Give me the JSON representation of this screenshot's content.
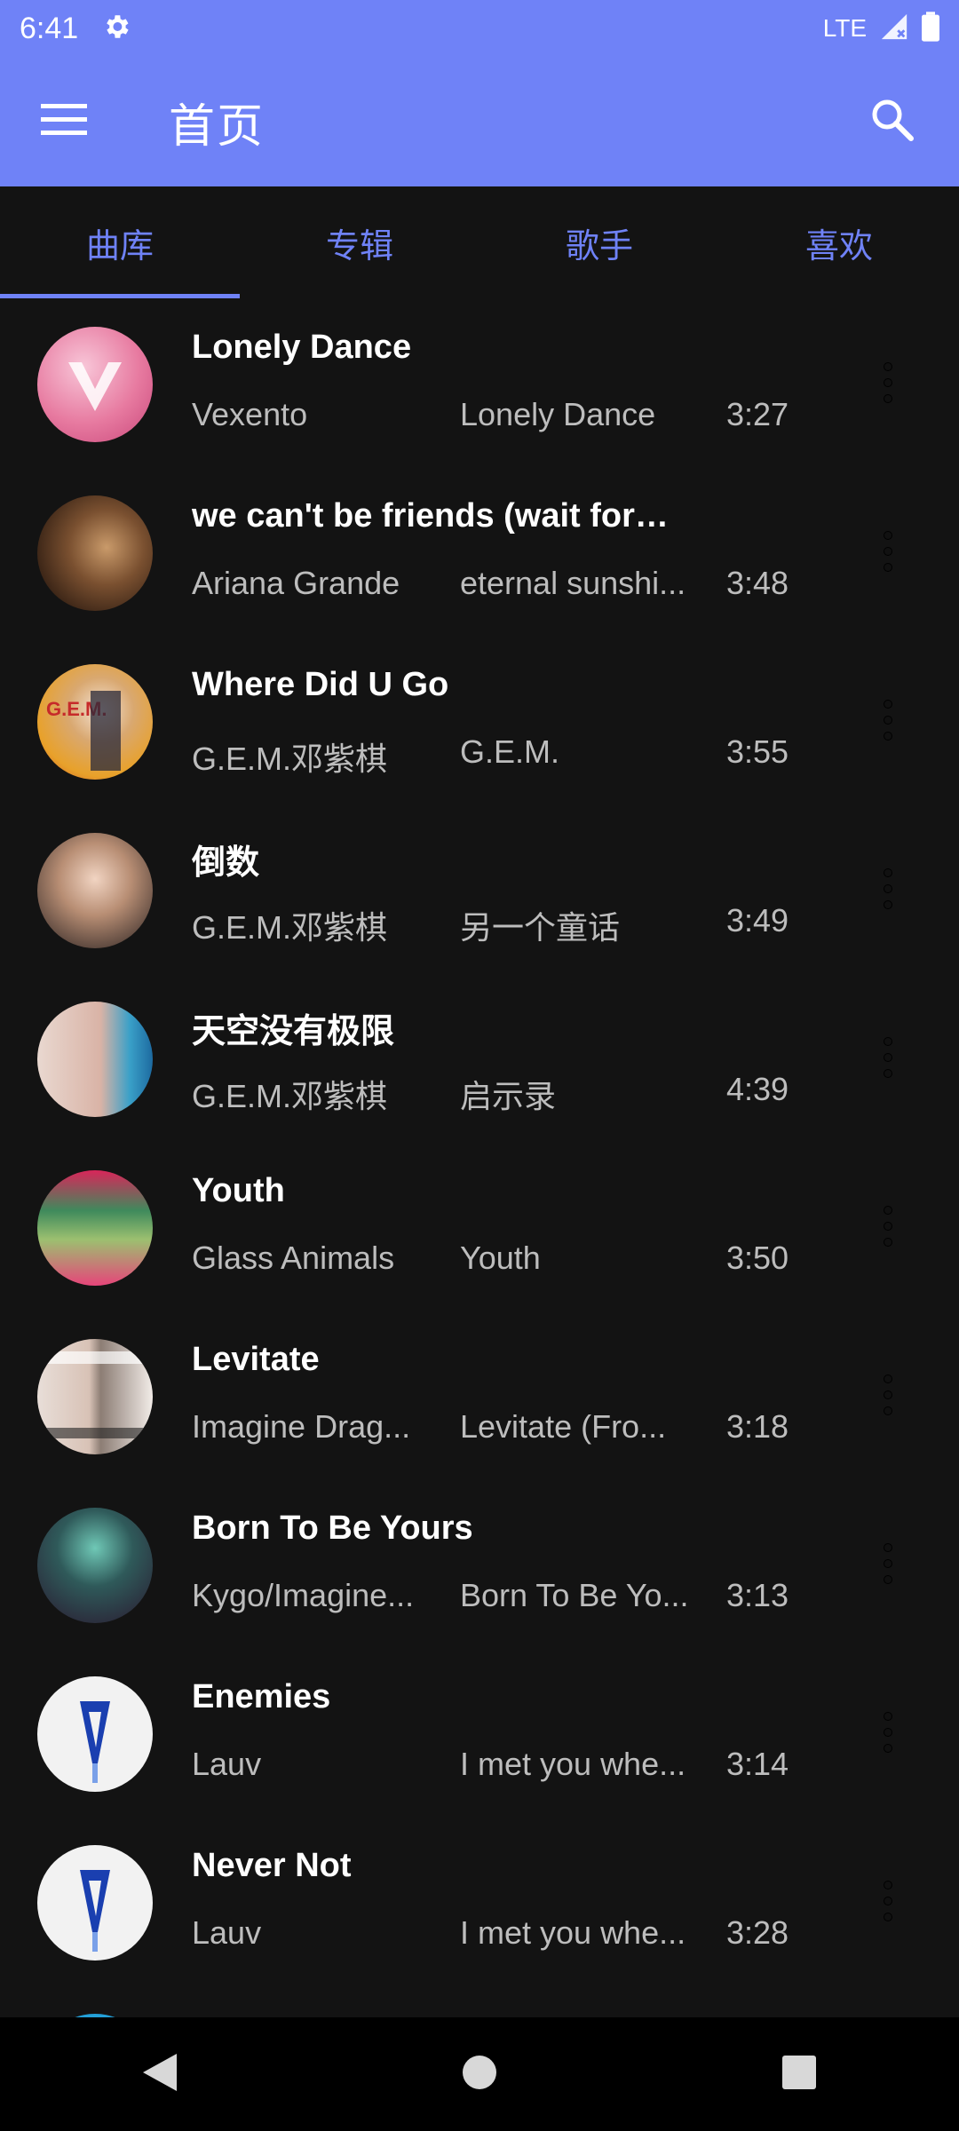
{
  "status_bar": {
    "time": "6:41",
    "network": "LTE"
  },
  "app_bar": {
    "title": "首页"
  },
  "tabs": [
    {
      "label": "曲库",
      "active": true
    },
    {
      "label": "专辑",
      "active": false
    },
    {
      "label": "歌手",
      "active": false
    },
    {
      "label": "喜欢",
      "active": false
    }
  ],
  "songs": [
    {
      "title": "Lonely Dance",
      "artist": "Vexento",
      "album": "Lonely Dance",
      "duration": "3:27"
    },
    {
      "title": "we can't be friends (wait for y...",
      "artist": "Ariana Grande",
      "album": "eternal sunshi...",
      "duration": "3:48"
    },
    {
      "title": "Where Did U Go",
      "artist": "G.E.M.邓紫棋",
      "album": "G.E.M.",
      "duration": "3:55"
    },
    {
      "title": "倒数",
      "artist": "G.E.M.邓紫棋",
      "album": "另一个童话",
      "duration": "3:49"
    },
    {
      "title": "天空没有极限",
      "artist": "G.E.M.邓紫棋",
      "album": "启示录",
      "duration": "4:39"
    },
    {
      "title": "Youth",
      "artist": "Glass Animals",
      "album": "Youth",
      "duration": "3:50"
    },
    {
      "title": "Levitate",
      "artist": "Imagine Drag...",
      "album": "Levitate (Fro...",
      "duration": "3:18"
    },
    {
      "title": "Born To Be Yours",
      "artist": "Kygo/Imagine...",
      "album": "Born To Be Yo...",
      "duration": "3:13"
    },
    {
      "title": "Enemies",
      "artist": "Lauv",
      "album": "I met you whe...",
      "duration": "3:14"
    },
    {
      "title": "Never Not",
      "artist": "Lauv",
      "album": "I met you whe...",
      "duration": "3:28"
    }
  ],
  "colors": {
    "accent": "#6f82f7",
    "background": "#131313",
    "title_text": "#ffffff",
    "secondary_text": "#bdbdbd",
    "navbar": "#000000"
  },
  "icons": {
    "menu": "hamburger-menu-icon",
    "search": "search-icon",
    "settings": "gear-icon",
    "more": "more-vert-icon",
    "back": "back-triangle-icon",
    "home": "home-circle-icon",
    "recents": "recents-square-icon"
  }
}
